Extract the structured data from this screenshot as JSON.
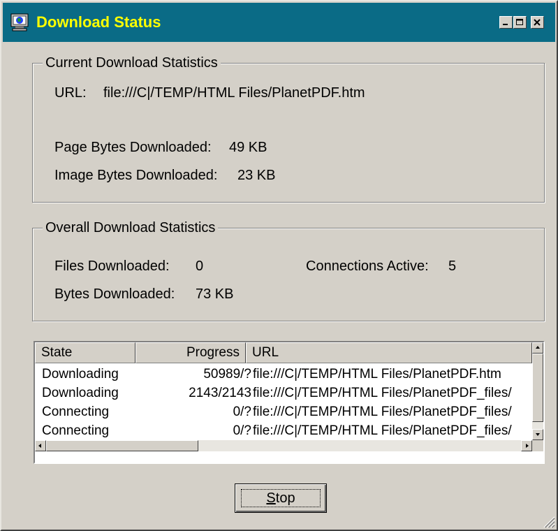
{
  "window": {
    "title": "Download Status",
    "title_color": "#ffff00",
    "titlebar_color": "#0a6b86",
    "face_color": "#d4d0c8"
  },
  "current": {
    "group_label": "Current Download Statistics",
    "url_label": "URL:",
    "url_value": "file:///C|/TEMP/HTML Files/PlanetPDF.htm",
    "page_bytes_label": "Page Bytes Downloaded:",
    "page_bytes_value": "49 KB",
    "image_bytes_label": "Image Bytes Downloaded:",
    "image_bytes_value": "23 KB"
  },
  "overall": {
    "group_label": "Overall Download Statistics",
    "files_label": "Files Downloaded:",
    "files_value": "0",
    "connections_label": "Connections Active:",
    "connections_value": "5",
    "bytes_label": "Bytes Downloaded:",
    "bytes_value": "73 KB"
  },
  "list": {
    "columns": [
      "State",
      "Progress",
      "URL"
    ],
    "rows": [
      {
        "state": "Downloading",
        "progress": "50989/?",
        "url": "file:///C|/TEMP/HTML Files/PlanetPDF.htm"
      },
      {
        "state": "Downloading",
        "progress": "2143/2143",
        "url": "file:///C|/TEMP/HTML Files/PlanetPDF_files/"
      },
      {
        "state": "Connecting",
        "progress": "0/?",
        "url": "file:///C|/TEMP/HTML Files/PlanetPDF_files/"
      },
      {
        "state": "Connecting",
        "progress": "0/?",
        "url": "file:///C|/TEMP/HTML Files/PlanetPDF_files/"
      }
    ]
  },
  "stop_button": {
    "mnemonic": "S",
    "rest": "top"
  },
  "icons": {
    "app": "globe-computer-icon",
    "minimize": "minimize-icon",
    "maximize": "maximize-icon",
    "close": "close-icon",
    "scroll_up": "arrow-up-icon",
    "scroll_down": "arrow-down-icon",
    "scroll_left": "arrow-left-icon",
    "scroll_right": "arrow-right-icon",
    "resize_grip": "resize-grip-icon"
  }
}
